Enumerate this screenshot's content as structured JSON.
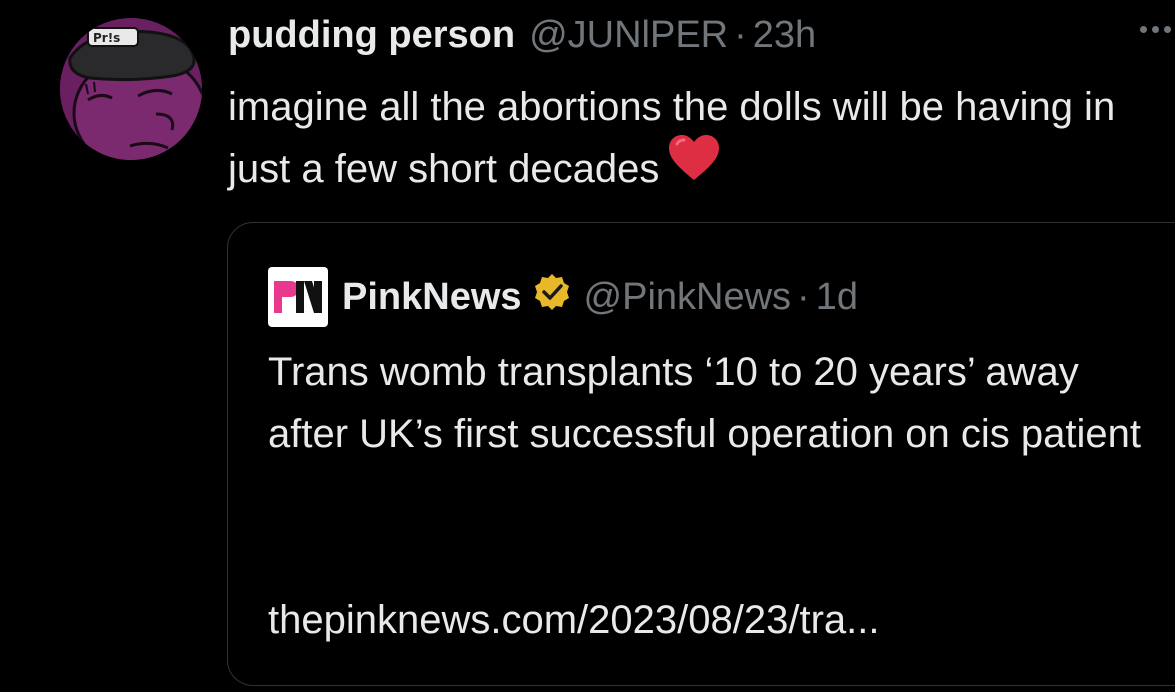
{
  "tweet": {
    "display_name": "pudding person",
    "handle": "@JUNlPER",
    "separator": "·",
    "time": "23h",
    "text": "imagine all the abortions the dolls will be having in just a few short decades",
    "emoji": "heart-emoji",
    "avatar": {
      "icon": "avatar-image",
      "hat_text": "Pr!s",
      "bg_color": "#6a1f60"
    },
    "more_icon": "more-options-icon"
  },
  "quote": {
    "logo_text": "PN",
    "display_name": "PinkNews",
    "verified_icon": "verified-badge-icon",
    "verified_color": "#e8b829",
    "handle": "@PinkNews",
    "separator": "·",
    "time": "1d",
    "text": "Trans womb transplants ‘10 to 20 years’ away after UK’s first successful operation on cis patient",
    "link": "thepinknews.com/2023/08/23/tra..."
  },
  "colors": {
    "background": "#000000",
    "text": "#e7e9ea",
    "secondary": "#71767b",
    "border": "#2f3336",
    "pn_pink": "#e8398c"
  }
}
